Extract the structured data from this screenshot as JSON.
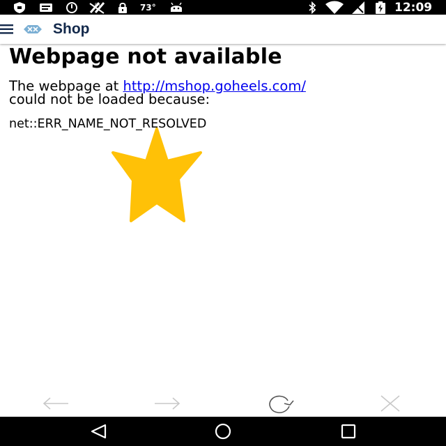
{
  "status_bar": {
    "temperature": "73°",
    "time": "12:09",
    "icons": [
      "shield-icon",
      "message-icon",
      "alarm-icon",
      "no-signal-icon",
      "lock-icon",
      "android-icon",
      "bluetooth-icon",
      "wifi-icon",
      "cellular-icon",
      "battery-icon"
    ]
  },
  "app_bar": {
    "title": "Shop",
    "brand_color": "#7BAFD4",
    "title_color": "#13294B"
  },
  "error": {
    "title": "Webpage not available",
    "message_prefix": "The webpage at ",
    "url": "http://mshop.goheels.com/",
    "message_suffix": "could not be loaded because:",
    "code": "net::ERR_NAME_NOT_RESOLVED"
  },
  "overlay": {
    "icon": "star-icon",
    "color": "#FFC107"
  },
  "browser_nav": {
    "icons": [
      "back-arrow-icon",
      "forward-arrow-icon",
      "refresh-icon",
      "close-icon"
    ]
  },
  "system_nav": {
    "icons": [
      "back-triangle-icon",
      "home-circle-icon",
      "recents-square-icon"
    ]
  }
}
